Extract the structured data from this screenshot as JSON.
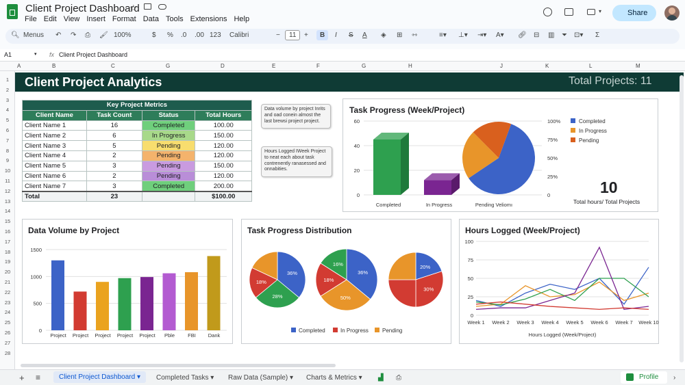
{
  "app": {
    "doc_title": "Client Project Dashboard",
    "menus": [
      "File",
      "Edit",
      "View",
      "Insert",
      "Format",
      "Data",
      "Tools",
      "Extensions",
      "Help"
    ],
    "share_label": "Share"
  },
  "toolbar": {
    "menus_label": "Menus",
    "zoom": "100%",
    "percent": "%",
    "dollar": "$",
    "decimal_dec": ".0",
    "decimal_inc": ".00",
    "format_123": "123",
    "font": "Calibri",
    "font_size": "11"
  },
  "formula": {
    "cell_ref": "A1",
    "content": "Client Project Dashboard"
  },
  "columns": [
    "A",
    "B",
    "C",
    "G",
    "D",
    "E",
    "F",
    "G",
    "H",
    "J",
    "K",
    "L",
    "M"
  ],
  "rows": [
    "1",
    "2",
    "3",
    "4",
    "5",
    "6",
    "7",
    "8",
    "9",
    "10",
    "11",
    "12",
    "13",
    "14",
    "15",
    "16",
    "17",
    "18",
    "19",
    "20",
    "21",
    "22",
    "23",
    "24",
    "25",
    "26",
    "27",
    "28"
  ],
  "banner": {
    "title": "Client Project Analytics",
    "total": "Total Projects: 11"
  },
  "metrics": {
    "caption": "Key Project Metrics",
    "headers": [
      "Client Name",
      "Task Count",
      "Status",
      "Total Hours"
    ],
    "rows": [
      [
        "Client Name 1",
        "16",
        "Completed",
        "100.00"
      ],
      [
        "Client Name 2",
        "6",
        "In Progress",
        "150.00"
      ],
      [
        "Client Name 3",
        "5",
        "Pending",
        "120.00"
      ],
      [
        "Client Name 4",
        "2",
        "Pending",
        "120.00"
      ],
      [
        "Client Name 5",
        "3",
        "Pending",
        "150.00"
      ],
      [
        "Client Name 6",
        "2",
        "Pending",
        "120.00"
      ],
      [
        "Client Name 7",
        "3",
        "Completed",
        "200.00"
      ]
    ],
    "total": [
      "Total",
      "23",
      "",
      "$100.00"
    ]
  },
  "notes": {
    "note1": "Data volume by project Inrits and oad conein almost the last brewsi project project.",
    "note2": "Hours Logged IWeek Project to neat each about task contrenently ranasessed and onnabities."
  },
  "kpi": {
    "value": "10",
    "label": "Total hours/ Total Projects"
  },
  "colors": {
    "completed": "#3c63c7",
    "in_progress": "#e8952a",
    "pending": "#d9601e",
    "green": "#2ea04f",
    "purple": "#7a2591",
    "red": "#d23b32"
  },
  "chart_data": [
    {
      "type": "bar",
      "title": "Task Progress (Week/Project)",
      "categories": [
        "Completed",
        "In Progress",
        "Pending Veliomı"
      ],
      "values": [
        45,
        12,
        0
      ],
      "ylim": [
        0,
        60
      ],
      "yticks": [
        "0",
        "20",
        "40",
        "60"
      ],
      "pie": {
        "values": [
          60,
          22,
          18
        ],
        "legend": [
          "Completed",
          "In Progress",
          "Pending"
        ]
      },
      "pct_ticks": [
        "0",
        "25%",
        "50%",
        "75%",
        "100%"
      ]
    },
    {
      "type": "bar",
      "title": "Data Volume by Project",
      "categories": [
        "Project",
        "Project",
        "Project",
        "Project",
        "Project",
        "Pble",
        "FBI",
        "Dank"
      ],
      "values": [
        1300,
        720,
        900,
        970,
        990,
        1060,
        1080,
        1380
      ],
      "colors": [
        "#3c63c7",
        "#d23b32",
        "#eaa31f",
        "#2ea04f",
        "#7a2591",
        "#b35bd1",
        "#e8952a",
        "#c19a1b"
      ],
      "ylim": [
        0,
        1500
      ],
      "yticks": [
        "0",
        "500",
        "1000",
        "1500"
      ]
    },
    {
      "type": "pie",
      "title": "Task Progress Distribution",
      "pies": [
        {
          "labels": [
            "36%",
            "28%",
            "18%",
            ""
          ],
          "values": [
            36,
            28,
            18,
            18
          ]
        },
        {
          "labels": [
            "36%",
            "50%",
            "18%",
            "16%"
          ],
          "values": [
            36,
            30,
            18,
            16
          ]
        },
        {
          "labels": [
            "20%",
            "30%",
            "",
            ""
          ],
          "values": [
            20,
            30,
            25,
            25
          ]
        }
      ],
      "legend": [
        "Completed",
        "In Progress",
        "Pending"
      ]
    },
    {
      "type": "line",
      "title": "Hours Logged (Week/Project)",
      "xlabel": "Hours Logged (Week/Project)",
      "x": [
        "Week 1",
        "Week 2",
        "Week 3",
        "Week 4",
        "Week 5",
        "Week 6",
        "Week 7",
        "Week 10"
      ],
      "ylim": [
        0,
        100
      ],
      "yticks": [
        "0",
        "25",
        "50",
        "75",
        "100"
      ],
      "series": [
        {
          "color": "#3c63c7",
          "values": [
            20,
            12,
            30,
            42,
            35,
            50,
            15,
            65
          ]
        },
        {
          "color": "#e8952a",
          "values": [
            12,
            15,
            40,
            25,
            28,
            45,
            20,
            30
          ]
        },
        {
          "color": "#2ea04f",
          "values": [
            18,
            14,
            22,
            35,
            20,
            50,
            50,
            25
          ]
        },
        {
          "color": "#7a2591",
          "values": [
            8,
            10,
            10,
            20,
            30,
            92,
            8,
            12
          ]
        },
        {
          "color": "#d23b32",
          "values": [
            15,
            18,
            15,
            12,
            10,
            8,
            10,
            8
          ]
        }
      ]
    }
  ],
  "tabs": [
    "Client Project Dashboard",
    "Completed Tasks",
    "Raw Data (Sample)",
    "Charts & Metrics"
  ],
  "profile_label": "Profile"
}
